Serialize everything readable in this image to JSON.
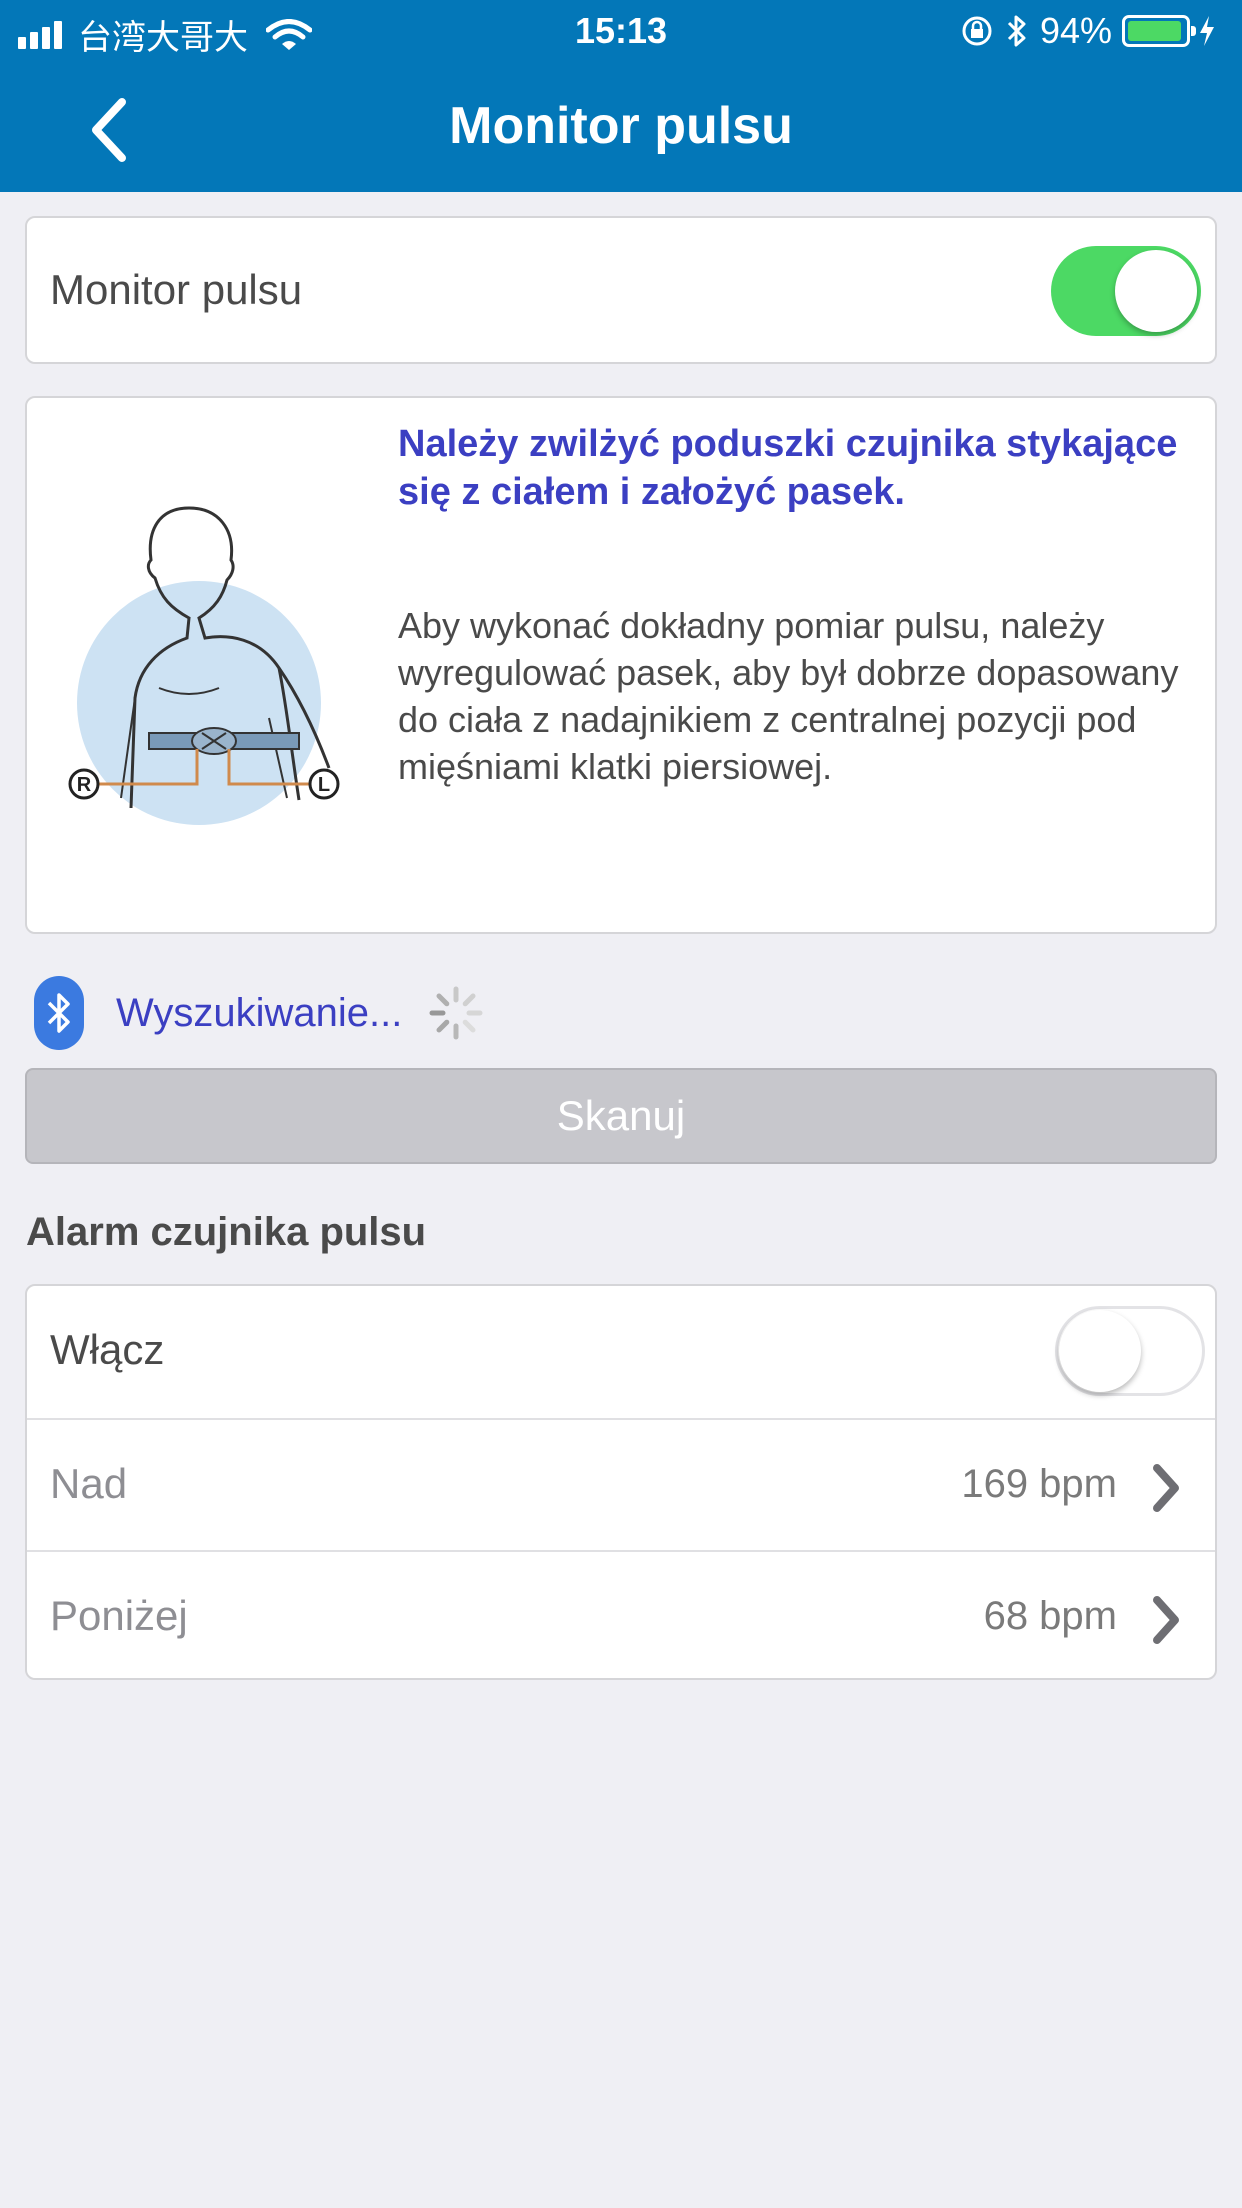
{
  "status_bar": {
    "carrier": "台湾大哥大",
    "time": "15:13",
    "battery_percent": "94%",
    "battery_level": 0.94
  },
  "nav": {
    "title": "Monitor pulsu"
  },
  "monitor_card": {
    "label": "Monitor pulsu",
    "toggle_on": true
  },
  "info_card": {
    "heading": "Należy zwilżyć poduszki czujnika stykające się z ciałem i założyć pasek.",
    "body": "Aby wykonać dokładny pomiar pulsu, należy wyregulować pasek, aby był dobrze dopasowany do ciała z nadajnikiem z centralnej pozycji pod mięśniami klatki piersiowej.",
    "illustration_labels": {
      "right": "R",
      "left": "L"
    }
  },
  "bluetooth": {
    "status": "Wyszukiwanie..."
  },
  "scan_button": {
    "label": "Skanuj"
  },
  "alarm_section": {
    "title": "Alarm czujnika pulsu",
    "enable_label": "Włącz",
    "enable_on": false,
    "rows": [
      {
        "label": "Nad",
        "value": "169 bpm"
      },
      {
        "label": "Poniżej",
        "value": "68 bpm"
      }
    ]
  },
  "colors": {
    "header": "#0377b8",
    "accent_text": "#3b3fc2",
    "toggle_on": "#4cd964",
    "background": "#efeff4"
  }
}
